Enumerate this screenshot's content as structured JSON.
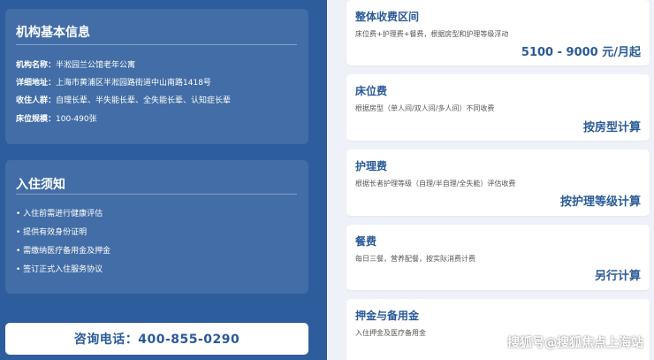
{
  "colors": {
    "left_bg": "#2d5d9c",
    "right_bg": "#eef2f8",
    "accent": "#2a5a98",
    "card_bg": "#ffffff"
  },
  "info_panel": {
    "title": "机构基本信息",
    "rows": [
      {
        "label": "机构名称：",
        "value": "半淞园兰公馆老年公寓"
      },
      {
        "label": "详细地址：",
        "value": "上海市黄浦区半淞园路街道中山南路1418号"
      },
      {
        "label": "收住人群：",
        "value": "自理长辈、半失能长辈、全失能长辈、认知症长辈"
      },
      {
        "label": "床位规模：",
        "value": "100-490张"
      }
    ]
  },
  "notice_panel": {
    "title": "入住须知",
    "items": [
      "• 入住前需进行健康评估",
      "• 提供有效身份证明",
      "• 需缴纳医疗备用金及押金",
      "• 签订正式入住服务协议"
    ]
  },
  "phone_button": {
    "label": "咨询电话：400-855-0290"
  },
  "fee_cards": [
    {
      "title": "整体收费区间",
      "desc": "床位费+护理费+餐费，根据房型和护理等级浮动",
      "price": "5100 - 9000 元/月起"
    },
    {
      "title": "床位费",
      "desc": "根据房型（单人间/双人间/多人间）不同收费",
      "price": "按房型计算"
    },
    {
      "title": "护理费",
      "desc": "根据长者护理等级（自理/半自理/全失能）评估收费",
      "price": "按护理等级计算"
    },
    {
      "title": "餐费",
      "desc": "每日三餐，营养配餐，按实际消费计费",
      "price": "另行计算"
    },
    {
      "title": "押金与备用金",
      "desc": "入住押金及医疗备用金",
      "price": ""
    }
  ],
  "watermark": "搜狐号@搜狐焦点上海站"
}
